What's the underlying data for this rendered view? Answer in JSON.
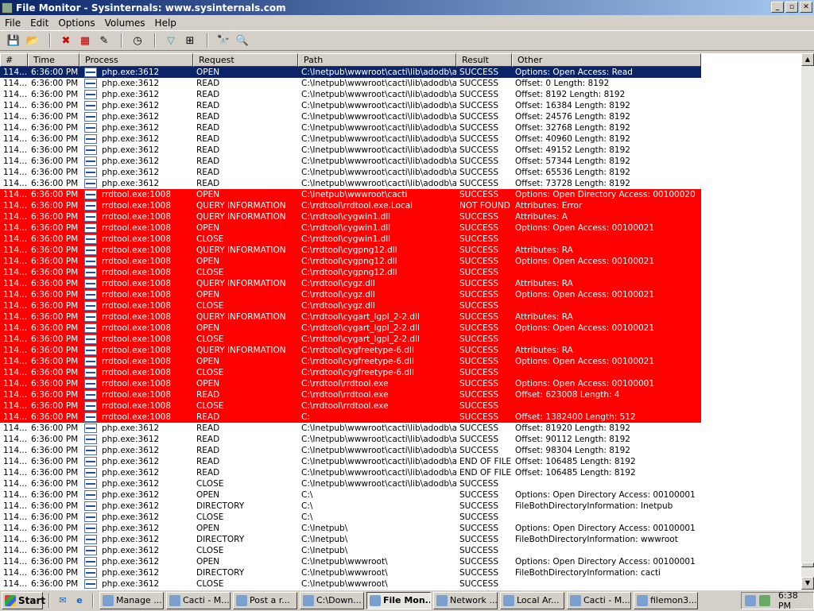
{
  "window": {
    "title": "File Monitor - Sysinternals: www.sysinternals.com"
  },
  "menu": [
    "File",
    "Edit",
    "Options",
    "Volumes",
    "Help"
  ],
  "toolbar": [
    "save-icon",
    "open-icon",
    "capture-icon",
    "autoscroll-icon",
    "clear-icon",
    "time-icon",
    "filter-icon",
    "highlight-icon",
    "find-icon",
    "explorer-jump-icon"
  ],
  "columns": [
    "#",
    "Time",
    "Process",
    "Request",
    "Path",
    "Result",
    "Other"
  ],
  "colors": {
    "highlight": "#ff0000",
    "selected": "#0a246a"
  },
  "rows": [
    [
      "114...",
      "6:36:00 PM",
      "php.exe:3612",
      "OPEN",
      "C:\\Inetpub\\wwwroot\\cacti\\lib\\adodb\\a...",
      "SUCCESS",
      "Options: Open Access: Read",
      "sel"
    ],
    [
      "114...",
      "6:36:00 PM",
      "php.exe:3612",
      "READ",
      "C:\\Inetpub\\wwwroot\\cacti\\lib\\adodb\\a...",
      "SUCCESS",
      "Offset: 0 Length: 8192",
      ""
    ],
    [
      "114...",
      "6:36:00 PM",
      "php.exe:3612",
      "READ",
      "C:\\Inetpub\\wwwroot\\cacti\\lib\\adodb\\a...",
      "SUCCESS",
      "Offset: 8192 Length: 8192",
      ""
    ],
    [
      "114...",
      "6:36:00 PM",
      "php.exe:3612",
      "READ",
      "C:\\Inetpub\\wwwroot\\cacti\\lib\\adodb\\a...",
      "SUCCESS",
      "Offset: 16384 Length: 8192",
      ""
    ],
    [
      "114...",
      "6:36:00 PM",
      "php.exe:3612",
      "READ",
      "C:\\Inetpub\\wwwroot\\cacti\\lib\\adodb\\a...",
      "SUCCESS",
      "Offset: 24576 Length: 8192",
      ""
    ],
    [
      "114...",
      "6:36:00 PM",
      "php.exe:3612",
      "READ",
      "C:\\Inetpub\\wwwroot\\cacti\\lib\\adodb\\a...",
      "SUCCESS",
      "Offset: 32768 Length: 8192",
      ""
    ],
    [
      "114...",
      "6:36:00 PM",
      "php.exe:3612",
      "READ",
      "C:\\Inetpub\\wwwroot\\cacti\\lib\\adodb\\a...",
      "SUCCESS",
      "Offset: 40960 Length: 8192",
      ""
    ],
    [
      "114...",
      "6:36:00 PM",
      "php.exe:3612",
      "READ",
      "C:\\Inetpub\\wwwroot\\cacti\\lib\\adodb\\a...",
      "SUCCESS",
      "Offset: 49152 Length: 8192",
      ""
    ],
    [
      "114...",
      "6:36:00 PM",
      "php.exe:3612",
      "READ",
      "C:\\Inetpub\\wwwroot\\cacti\\lib\\adodb\\a...",
      "SUCCESS",
      "Offset: 57344 Length: 8192",
      ""
    ],
    [
      "114...",
      "6:36:00 PM",
      "php.exe:3612",
      "READ",
      "C:\\Inetpub\\wwwroot\\cacti\\lib\\adodb\\a...",
      "SUCCESS",
      "Offset: 65536 Length: 8192",
      ""
    ],
    [
      "114...",
      "6:36:00 PM",
      "php.exe:3612",
      "READ",
      "C:\\Inetpub\\wwwroot\\cacti\\lib\\adodb\\a...",
      "SUCCESS",
      "Offset: 73728 Length: 8192",
      ""
    ],
    [
      "114...",
      "6:36:00 PM",
      "rrdtool.exe:1008",
      "OPEN",
      "C:\\inetpub\\wwwroot\\cacti",
      "SUCCESS",
      "Options: Open Directory  Access: 00100020",
      "red"
    ],
    [
      "114...",
      "6:36:00 PM",
      "rrdtool.exe:1008",
      "QUERY INFORMATION",
      "C:\\rrdtool\\rrdtool.exe.Local",
      "NOT FOUND",
      "Attributes: Error",
      "red"
    ],
    [
      "114...",
      "6:36:00 PM",
      "rrdtool.exe:1008",
      "QUERY INFORMATION",
      "C:\\rrdtool\\cygwin1.dll",
      "SUCCESS",
      "Attributes: A",
      "red"
    ],
    [
      "114...",
      "6:36:00 PM",
      "rrdtool.exe:1008",
      "OPEN",
      "C:\\rrdtool\\cygwin1.dll",
      "SUCCESS",
      "Options: Open  Access: 00100021",
      "red"
    ],
    [
      "114...",
      "6:36:00 PM",
      "rrdtool.exe:1008",
      "CLOSE",
      "C:\\rrdtool\\cygwin1.dll",
      "SUCCESS",
      "",
      "red"
    ],
    [
      "114...",
      "6:36:00 PM",
      "rrdtool.exe:1008",
      "QUERY INFORMATION",
      "C:\\rrdtool\\cygpng12.dll",
      "SUCCESS",
      "Attributes: RA",
      "red"
    ],
    [
      "114...",
      "6:36:00 PM",
      "rrdtool.exe:1008",
      "OPEN",
      "C:\\rrdtool\\cygpng12.dll",
      "SUCCESS",
      "Options: Open  Access: 00100021",
      "red"
    ],
    [
      "114...",
      "6:36:00 PM",
      "rrdtool.exe:1008",
      "CLOSE",
      "C:\\rrdtool\\cygpng12.dll",
      "SUCCESS",
      "",
      "red"
    ],
    [
      "114...",
      "6:36:00 PM",
      "rrdtool.exe:1008",
      "QUERY INFORMATION",
      "C:\\rrdtool\\cygz.dll",
      "SUCCESS",
      "Attributes: RA",
      "red"
    ],
    [
      "114...",
      "6:36:00 PM",
      "rrdtool.exe:1008",
      "OPEN",
      "C:\\rrdtool\\cygz.dll",
      "SUCCESS",
      "Options: Open  Access: 00100021",
      "red"
    ],
    [
      "114...",
      "6:36:00 PM",
      "rrdtool.exe:1008",
      "CLOSE",
      "C:\\rrdtool\\cygz.dll",
      "SUCCESS",
      "",
      "red"
    ],
    [
      "114...",
      "6:36:00 PM",
      "rrdtool.exe:1008",
      "QUERY INFORMATION",
      "C:\\rrdtool\\cygart_lgpl_2-2.dll",
      "SUCCESS",
      "Attributes: RA",
      "red"
    ],
    [
      "114...",
      "6:36:00 PM",
      "rrdtool.exe:1008",
      "OPEN",
      "C:\\rrdtool\\cygart_lgpl_2-2.dll",
      "SUCCESS",
      "Options: Open  Access: 00100021",
      "red"
    ],
    [
      "114...",
      "6:36:00 PM",
      "rrdtool.exe:1008",
      "CLOSE",
      "C:\\rrdtool\\cygart_lgpl_2-2.dll",
      "SUCCESS",
      "",
      "red"
    ],
    [
      "114...",
      "6:36:00 PM",
      "rrdtool.exe:1008",
      "QUERY INFORMATION",
      "C:\\rrdtool\\cygfreetype-6.dll",
      "SUCCESS",
      "Attributes: RA",
      "red"
    ],
    [
      "114...",
      "6:36:00 PM",
      "rrdtool.exe:1008",
      "OPEN",
      "C:\\rrdtool\\cygfreetype-6.dll",
      "SUCCESS",
      "Options: Open  Access: 00100021",
      "red"
    ],
    [
      "114...",
      "6:36:00 PM",
      "rrdtool.exe:1008",
      "CLOSE",
      "C:\\rrdtool\\cygfreetype-6.dll",
      "SUCCESS",
      "",
      "red"
    ],
    [
      "114...",
      "6:36:00 PM",
      "rrdtool.exe:1008",
      "OPEN",
      "C:\\rrdtool\\rrdtool.exe",
      "SUCCESS",
      "Options: Open  Access: 00100001",
      "red"
    ],
    [
      "114...",
      "6:36:00 PM",
      "rrdtool.exe:1008",
      "READ",
      "C:\\rrdtool\\rrdtool.exe",
      "SUCCESS",
      "Offset: 623008 Length: 4",
      "red"
    ],
    [
      "114...",
      "6:36:00 PM",
      "rrdtool.exe:1008",
      "CLOSE",
      "C:\\rrdtool\\rrdtool.exe",
      "SUCCESS",
      "",
      "red"
    ],
    [
      "114...",
      "6:36:00 PM",
      "rrdtool.exe:1008",
      "READ",
      "C:",
      "SUCCESS",
      "Offset: 1382400 Length: 512",
      "red"
    ],
    [
      "114...",
      "6:36:00 PM",
      "php.exe:3612",
      "READ",
      "C:\\Inetpub\\wwwroot\\cacti\\lib\\adodb\\a...",
      "SUCCESS",
      "Offset: 81920 Length: 8192",
      ""
    ],
    [
      "114...",
      "6:36:00 PM",
      "php.exe:3612",
      "READ",
      "C:\\Inetpub\\wwwroot\\cacti\\lib\\adodb\\a...",
      "SUCCESS",
      "Offset: 90112 Length: 8192",
      ""
    ],
    [
      "114...",
      "6:36:00 PM",
      "php.exe:3612",
      "READ",
      "C:\\Inetpub\\wwwroot\\cacti\\lib\\adodb\\a...",
      "SUCCESS",
      "Offset: 98304 Length: 8192",
      ""
    ],
    [
      "114...",
      "6:36:00 PM",
      "php.exe:3612",
      "READ",
      "C:\\Inetpub\\wwwroot\\cacti\\lib\\adodb\\a...",
      "END OF FILE",
      "Offset: 106485 Length: 8192",
      ""
    ],
    [
      "114...",
      "6:36:00 PM",
      "php.exe:3612",
      "READ",
      "C:\\Inetpub\\wwwroot\\cacti\\lib\\adodb\\a...",
      "END OF FILE",
      "Offset: 106485 Length: 8192",
      ""
    ],
    [
      "114...",
      "6:36:00 PM",
      "php.exe:3612",
      "CLOSE",
      "C:\\Inetpub\\wwwroot\\cacti\\lib\\adodb\\a...",
      "SUCCESS",
      "",
      ""
    ],
    [
      "114...",
      "6:36:00 PM",
      "php.exe:3612",
      "OPEN",
      "C:\\",
      "SUCCESS",
      "Options: Open Directory  Access: 00100001",
      ""
    ],
    [
      "114...",
      "6:36:00 PM",
      "php.exe:3612",
      "DIRECTORY",
      "C:\\",
      "SUCCESS",
      "FileBothDirectoryInformation: Inetpub",
      ""
    ],
    [
      "114...",
      "6:36:00 PM",
      "php.exe:3612",
      "CLOSE",
      "C:\\",
      "SUCCESS",
      "",
      ""
    ],
    [
      "114...",
      "6:36:00 PM",
      "php.exe:3612",
      "OPEN",
      "C:\\Inetpub\\",
      "SUCCESS",
      "Options: Open Directory  Access: 00100001",
      ""
    ],
    [
      "114...",
      "6:36:00 PM",
      "php.exe:3612",
      "DIRECTORY",
      "C:\\Inetpub\\",
      "SUCCESS",
      "FileBothDirectoryInformation: wwwroot",
      ""
    ],
    [
      "114...",
      "6:36:00 PM",
      "php.exe:3612",
      "CLOSE",
      "C:\\Inetpub\\",
      "SUCCESS",
      "",
      ""
    ],
    [
      "114...",
      "6:36:00 PM",
      "php.exe:3612",
      "OPEN",
      "C:\\Inetpub\\wwwroot\\",
      "SUCCESS",
      "Options: Open Directory  Access: 00100001",
      ""
    ],
    [
      "114...",
      "6:36:00 PM",
      "php.exe:3612",
      "DIRECTORY",
      "C:\\Inetpub\\wwwroot\\",
      "SUCCESS",
      "FileBothDirectoryInformation: cacti",
      ""
    ],
    [
      "114...",
      "6:36:00 PM",
      "php.exe:3612",
      "CLOSE",
      "C:\\Inetpub\\wwwroot\\",
      "SUCCESS",
      "",
      ""
    ]
  ],
  "taskbar": {
    "start": "Start",
    "tasks": [
      "Manage ...",
      "Cacti - M...",
      "Post a r...",
      "C:\\Down...",
      "File Mon...",
      "Network ...",
      "Local Ar...",
      "Cacti - M...",
      "filemon3..."
    ],
    "active": 4,
    "clock": "6:38 PM"
  }
}
